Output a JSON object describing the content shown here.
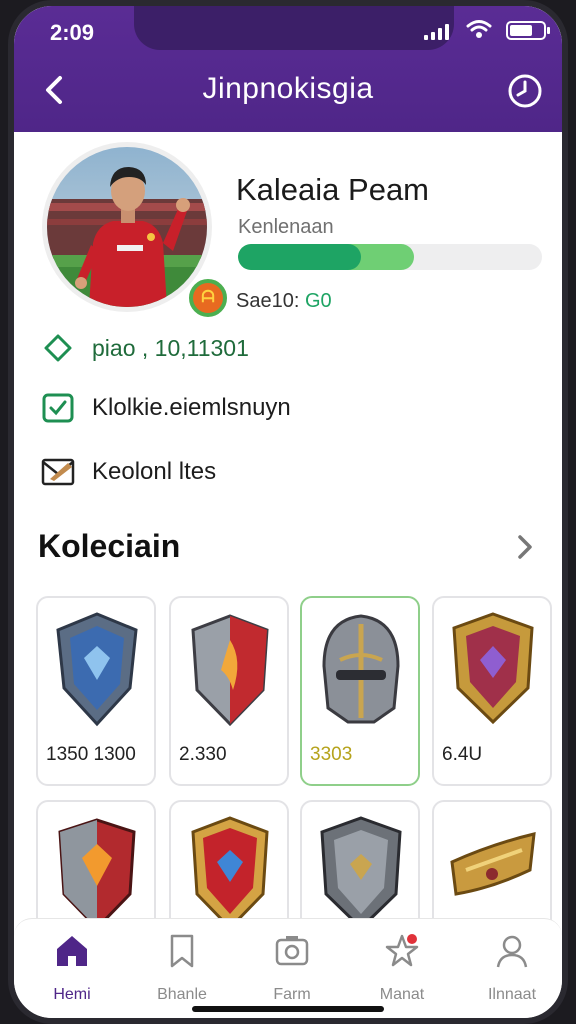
{
  "status_bar": {
    "time": "2:09"
  },
  "header": {
    "title": "Jinpnokisgia"
  },
  "profile": {
    "name": "Kaleaia Peam",
    "subtitle": "Kenlenaan",
    "score_label": "Sae10:",
    "score_value": "G0",
    "progress_fraction": 0.58,
    "progress_secondary_fraction": 0.58,
    "badge_icon": "team-crest-icon",
    "accent_color": "#1ea464"
  },
  "info_rows": [
    {
      "icon": "diamond-icon",
      "text": "piao , 10,11301"
    },
    {
      "icon": "checkbox-icon",
      "text": "Klolkie.eiemlsnuyn"
    },
    {
      "icon": "mail-icon",
      "text": "Keolonl ltes"
    }
  ],
  "collection": {
    "title": "Koleciain",
    "cards": [
      {
        "item": "blue-steel-shield",
        "price": "1350 1300"
      },
      {
        "item": "red-flame-shield",
        "price": "2.330"
      },
      {
        "item": "steel-helm-shield",
        "price": "3303",
        "selected": true
      },
      {
        "item": "purple-gold-shield",
        "price": "6.4U"
      },
      {
        "item": "red-orange-shield",
        "price": ""
      },
      {
        "item": "red-gold-shield",
        "price": ""
      },
      {
        "item": "grey-steel-shield",
        "price": ""
      },
      {
        "item": "gold-arm-guard",
        "price": ""
      }
    ]
  },
  "tabs": [
    {
      "label": "Hemi",
      "icon": "home-icon",
      "active": true
    },
    {
      "label": "Bhanle",
      "icon": "bookmark-icon",
      "active": false
    },
    {
      "label": "Farm",
      "icon": "camera-icon",
      "active": false
    },
    {
      "label": "Manat",
      "icon": "star-notification-icon",
      "active": false
    },
    {
      "label": "Ilnnaat",
      "icon": "profile-icon",
      "active": false
    }
  ],
  "colors": {
    "header": "#4f2688",
    "accent": "#1ea464"
  }
}
